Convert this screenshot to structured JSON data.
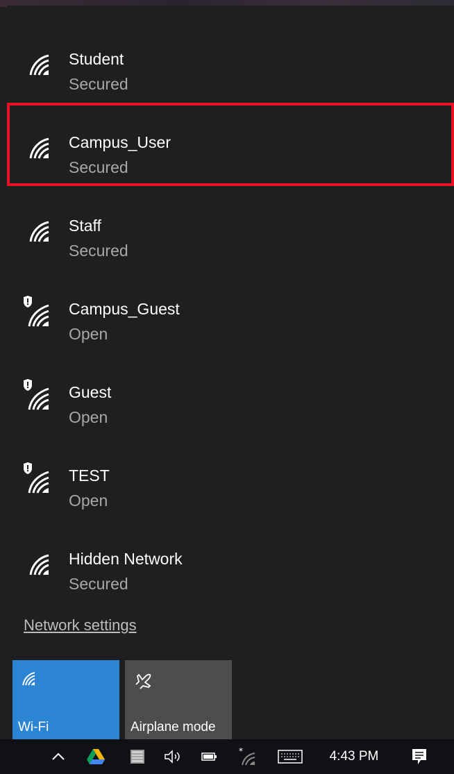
{
  "networks": [
    {
      "name": "Student",
      "status": "Secured",
      "open": false,
      "selected": false
    },
    {
      "name": "Campus_User",
      "status": "Secured",
      "open": false,
      "selected": true
    },
    {
      "name": "Staff",
      "status": "Secured",
      "open": false,
      "selected": false
    },
    {
      "name": "Campus_Guest",
      "status": "Open",
      "open": true,
      "selected": false
    },
    {
      "name": "Guest",
      "status": "Open",
      "open": true,
      "selected": false
    },
    {
      "name": "TEST",
      "status": "Open",
      "open": true,
      "selected": false
    },
    {
      "name": "Hidden Network",
      "status": "Secured",
      "open": false,
      "selected": false
    }
  ],
  "network_settings_label": "Network settings",
  "quick_actions": {
    "wifi": {
      "label": "Wi-Fi",
      "icon": "wifi-icon",
      "active": true
    },
    "airplane": {
      "label": "Airplane mode",
      "icon": "airplane-icon",
      "active": false
    }
  },
  "taskbar": {
    "time": "4:43 PM",
    "icons": [
      "chevron-up-icon",
      "google-drive-icon",
      "app-icon",
      "volume-icon",
      "battery-icon",
      "wifi-status-icon",
      "keyboard-icon",
      "action-center-icon"
    ]
  },
  "colors": {
    "selection_border": "#e81123",
    "wifi_tile": "#2b85d3",
    "airplane_tile": "#4d4d4f",
    "flyout_bg": "#1f1f21",
    "secondary_text": "#a8a8a8"
  }
}
